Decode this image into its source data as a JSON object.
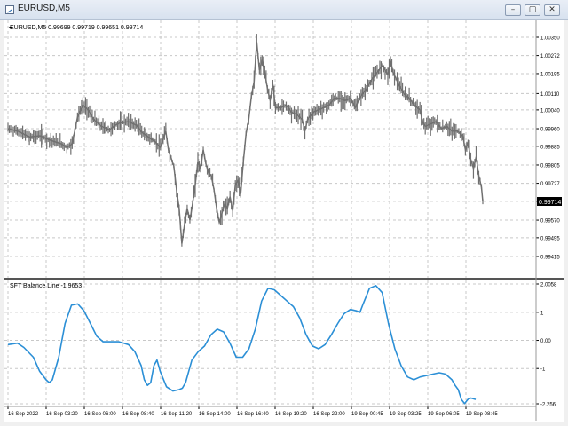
{
  "window": {
    "title": "EURUSD,M5",
    "buttons": {
      "minimize": "–",
      "maximize": "▢",
      "close": "✕"
    }
  },
  "main_chart": {
    "symbol_info": "EURUSD,M5  0.99699 0.99719 0.99651 0.99714",
    "current_price_label": "0.99714",
    "price_color": "#707070"
  },
  "indicator": {
    "label": "SFT Balance Line -1.9653",
    "line_color": "#2b8fd6"
  },
  "chart_data": [
    {
      "type": "bar",
      "subtype": "ohlc-price",
      "title": "EURUSD,M5",
      "ylim": [
        0.99415,
        1.0035
      ],
      "y_ticks": [
        "1.00350",
        "1.00272",
        "1.00195",
        "1.00110",
        "1.00040",
        "0.99960",
        "0.99885",
        "0.99805",
        "0.99727",
        "0.99650",
        "0.99570",
        "0.99495",
        "0.99415"
      ],
      "x_ticks": [
        "16 Sep 2022",
        "16 Sep 03:20",
        "16 Sep 06:00",
        "16 Sep 08:40",
        "16 Sep 11:20",
        "16 Sep 14:00",
        "16 Sep 16:40",
        "16 Sep 19:20",
        "16 Sep 22:00",
        "19 Sep 00:45",
        "19 Sep 03:25",
        "19 Sep 06:05",
        "19 Sep 08:45"
      ],
      "grid": true,
      "close_path": [
        [
          0,
          0.9996
        ],
        [
          4,
          0.99948
        ],
        [
          8,
          0.99925
        ],
        [
          12,
          0.9993
        ],
        [
          16,
          0.9991
        ],
        [
          20,
          0.99895
        ],
        [
          22,
          0.9988
        ],
        [
          24,
          0.99895
        ],
        [
          26,
          1.0001
        ],
        [
          28,
          1.0006
        ],
        [
          30,
          1.0004
        ],
        [
          32,
          1.0
        ],
        [
          35,
          0.9997
        ],
        [
          38,
          0.99955
        ],
        [
          40,
          0.99975
        ],
        [
          42,
          0.99985
        ],
        [
          45,
          0.9999
        ],
        [
          48,
          0.99975
        ],
        [
          50,
          0.99945
        ],
        [
          53,
          0.9992
        ],
        [
          55,
          0.99905
        ],
        [
          57,
          0.9988
        ],
        [
          59,
          0.9995
        ],
        [
          60,
          0.9987
        ],
        [
          62,
          0.998
        ],
        [
          63,
          0.997
        ],
        [
          64,
          0.9962
        ],
        [
          65,
          0.9947
        ],
        [
          66,
          0.9955
        ],
        [
          67,
          0.9962
        ],
        [
          68,
          0.9957
        ],
        [
          69,
          0.9964
        ],
        [
          70,
          0.9972
        ],
        [
          71,
          0.9982
        ],
        [
          72,
          0.9979
        ],
        [
          73,
          0.9987
        ],
        [
          74,
          0.9981
        ],
        [
          75,
          0.9977
        ],
        [
          76,
          0.9976
        ],
        [
          77,
          0.997
        ],
        [
          78,
          0.9962
        ],
        [
          79,
          0.9956
        ],
        [
          80,
          0.996
        ],
        [
          81,
          0.9964
        ],
        [
          82,
          0.9962
        ],
        [
          83,
          0.9967
        ],
        [
          84,
          0.9961
        ],
        [
          85,
          0.9972
        ],
        [
          86,
          0.9974
        ],
        [
          87,
          0.9968
        ],
        [
          88,
          0.9982
        ],
        [
          89,
          0.9994
        ],
        [
          90,
          1.0
        ],
        [
          91,
          1.001
        ],
        [
          92,
          1.0016
        ],
        [
          93,
          1.0033
        ],
        [
          94,
          1.0021
        ],
        [
          95,
          1.0025
        ],
        [
          96,
          1.002
        ],
        [
          97,
          1.0013
        ],
        [
          98,
          1.0008
        ],
        [
          99,
          1.0015
        ],
        [
          100,
          1.0005
        ],
        [
          102,
          1.0005
        ],
        [
          104,
          1.0006
        ],
        [
          106,
          1.0003
        ],
        [
          108,
          1.0002
        ],
        [
          110,
          1.0
        ],
        [
          111,
          0.9995
        ],
        [
          112,
          1.0
        ],
        [
          114,
          1.0003
        ],
        [
          116,
          1.0004
        ],
        [
          118,
          1.0005
        ],
        [
          120,
          1.0006
        ],
        [
          122,
          1.0009
        ],
        [
          124,
          1.0009
        ],
        [
          126,
          1.0008
        ],
        [
          128,
          1.0009
        ],
        [
          130,
          1.0005
        ],
        [
          131,
          1.0008
        ],
        [
          132,
          1.001
        ],
        [
          134,
          1.0013
        ],
        [
          136,
          1.0017
        ],
        [
          138,
          1.002
        ],
        [
          140,
          1.0023
        ],
        [
          142,
          1.0019
        ],
        [
          143,
          1.0025
        ],
        [
          144,
          1.002
        ],
        [
          146,
          1.0015
        ],
        [
          148,
          1.0011
        ],
        [
          150,
          1.0009
        ],
        [
          152,
          1.0006
        ],
        [
          154,
          1.0004
        ],
        [
          155,
          0.9999
        ],
        [
          156,
          0.9997
        ],
        [
          158,
          0.9998
        ],
        [
          160,
          0.9999
        ],
        [
          162,
          0.9996
        ],
        [
          164,
          0.9997
        ],
        [
          166,
          0.9995
        ],
        [
          168,
          0.9995
        ],
        [
          170,
          0.9993
        ],
        [
          171,
          0.9987
        ],
        [
          172,
          0.999
        ],
        [
          173,
          0.9983
        ],
        [
          174,
          0.9979
        ],
        [
          175,
          0.9984
        ],
        [
          176,
          0.9976
        ],
        [
          177,
          0.9971
        ],
        [
          177.5,
          0.9965
        ]
      ]
    },
    {
      "type": "line",
      "title": "SFT Balance Line -1.9653",
      "ylim": [
        -2.256,
        2.0058
      ],
      "y_ticks": [
        "2.0058",
        "1",
        "0.00",
        "-1",
        "-2.256"
      ],
      "grid": true,
      "series": [
        {
          "name": "SFT Balance Line",
          "values": [
            [
              0,
              -0.15
            ],
            [
              3,
              -0.1
            ],
            [
              5,
              -0.25
            ],
            [
              8,
              -0.6
            ],
            [
              10,
              -1.1
            ],
            [
              12,
              -1.4
            ],
            [
              13,
              -1.5
            ],
            [
              14,
              -1.4
            ],
            [
              16,
              -0.6
            ],
            [
              18,
              0.6
            ],
            [
              20,
              1.25
            ],
            [
              22,
              1.3
            ],
            [
              24,
              1.05
            ],
            [
              26,
              0.6
            ],
            [
              28,
              0.15
            ],
            [
              30,
              -0.05
            ],
            [
              32,
              -0.05
            ],
            [
              35,
              -0.05
            ],
            [
              38,
              -0.15
            ],
            [
              40,
              -0.4
            ],
            [
              42,
              -0.9
            ],
            [
              43,
              -1.4
            ],
            [
              44,
              -1.6
            ],
            [
              45,
              -1.5
            ],
            [
              46,
              -0.9
            ],
            [
              47,
              -0.7
            ],
            [
              48,
              -1.1
            ],
            [
              50,
              -1.65
            ],
            [
              52,
              -1.8
            ],
            [
              54,
              -1.75
            ],
            [
              55,
              -1.7
            ],
            [
              56,
              -1.5
            ],
            [
              58,
              -0.7
            ],
            [
              60,
              -0.4
            ],
            [
              62,
              -0.2
            ],
            [
              64,
              0.2
            ],
            [
              66,
              0.4
            ],
            [
              68,
              0.3
            ],
            [
              70,
              -0.1
            ],
            [
              72,
              -0.6
            ],
            [
              74,
              -0.6
            ],
            [
              76,
              -0.3
            ],
            [
              78,
              0.4
            ],
            [
              80,
              1.4
            ],
            [
              82,
              1.85
            ],
            [
              84,
              1.8
            ],
            [
              86,
              1.6
            ],
            [
              88,
              1.4
            ],
            [
              90,
              1.2
            ],
            [
              92,
              0.8
            ],
            [
              94,
              0.2
            ],
            [
              96,
              -0.2
            ],
            [
              98,
              -0.3
            ],
            [
              100,
              -0.15
            ],
            [
              102,
              0.2
            ],
            [
              104,
              0.6
            ],
            [
              106,
              0.95
            ],
            [
              108,
              1.1
            ],
            [
              110,
              1.05
            ],
            [
              111,
              1.0
            ],
            [
              112,
              1.3
            ],
            [
              114,
              1.85
            ],
            [
              116,
              1.95
            ],
            [
              118,
              1.7
            ],
            [
              120,
              0.6
            ],
            [
              122,
              -0.3
            ],
            [
              124,
              -0.9
            ],
            [
              126,
              -1.3
            ],
            [
              128,
              -1.4
            ],
            [
              130,
              -1.3
            ],
            [
              132,
              -1.25
            ],
            [
              134,
              -1.2
            ],
            [
              136,
              -1.15
            ],
            [
              138,
              -1.2
            ],
            [
              140,
              -1.4
            ],
            [
              141,
              -1.6
            ],
            [
              142,
              -1.75
            ],
            [
              143,
              -2.1
            ],
            [
              144,
              -2.25
            ],
            [
              145,
              -2.1
            ],
            [
              146,
              -2.05
            ],
            [
              147.5,
              -2.1
            ]
          ]
        }
      ]
    }
  ]
}
